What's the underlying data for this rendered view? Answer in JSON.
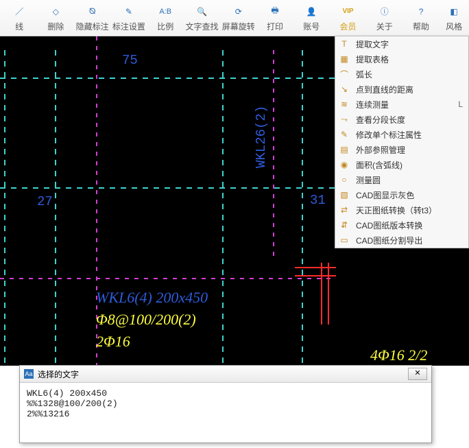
{
  "toolbar": [
    {
      "label": "线",
      "icon": "／"
    },
    {
      "label": "删除",
      "icon": "◇"
    },
    {
      "label": "隐藏标注",
      "icon": "⦰"
    },
    {
      "label": "标注设置",
      "icon": "✎"
    },
    {
      "label": "比例",
      "icon": "A:B"
    },
    {
      "label": "文字查找",
      "icon": "🔍"
    },
    {
      "label": "屏幕旋转",
      "icon": "⟳"
    },
    {
      "label": "打印",
      "icon": "🖶"
    },
    {
      "label": "账号",
      "icon": "👤"
    },
    {
      "label": "会员",
      "icon": "VIP",
      "vip": true
    },
    {
      "label": "关于",
      "icon": "ⓘ"
    },
    {
      "label": "帮助",
      "icon": "?"
    },
    {
      "label": "风格",
      "icon": "◧"
    }
  ],
  "menu": [
    {
      "label": "提取文字",
      "icon": "T"
    },
    {
      "label": "提取表格",
      "icon": "▦"
    },
    {
      "label": "弧长",
      "icon": "⌒"
    },
    {
      "label": "点到直线的距离",
      "icon": "↘"
    },
    {
      "label": "连续测量",
      "icon": "≋",
      "shortcut": "L"
    },
    {
      "label": "查看分段长度",
      "icon": "⤳"
    },
    {
      "label": "修改单个标注属性",
      "icon": "✎"
    },
    {
      "label": "外部参照管理",
      "icon": "▤"
    },
    {
      "label": "面积(含弧线)",
      "icon": "◉"
    },
    {
      "label": "测量圆",
      "icon": "○"
    },
    {
      "label": "CAD图显示灰色",
      "icon": "▧"
    },
    {
      "label": "天正图纸转换（转t3）",
      "icon": "⇄"
    },
    {
      "label": "CAD图纸版本转换",
      "icon": "⇵"
    },
    {
      "label": "CAD图纸分割导出",
      "icon": "▭"
    }
  ],
  "dims": {
    "top": "75",
    "left_axis": "27",
    "right_axis": "31",
    "wkl26": "WKL26(2)"
  },
  "annotations": {
    "line1": "WKL6(4) 200x450",
    "line2": "Φ8@100/200(2)",
    "line3": "2Φ16",
    "line4": "4Φ16 2/2"
  },
  "dialog": {
    "title": "选择的文字",
    "text_lines": [
      "WKL6(4) 200x450",
      "%%1328@100/200(2)",
      "2%%13216"
    ]
  }
}
